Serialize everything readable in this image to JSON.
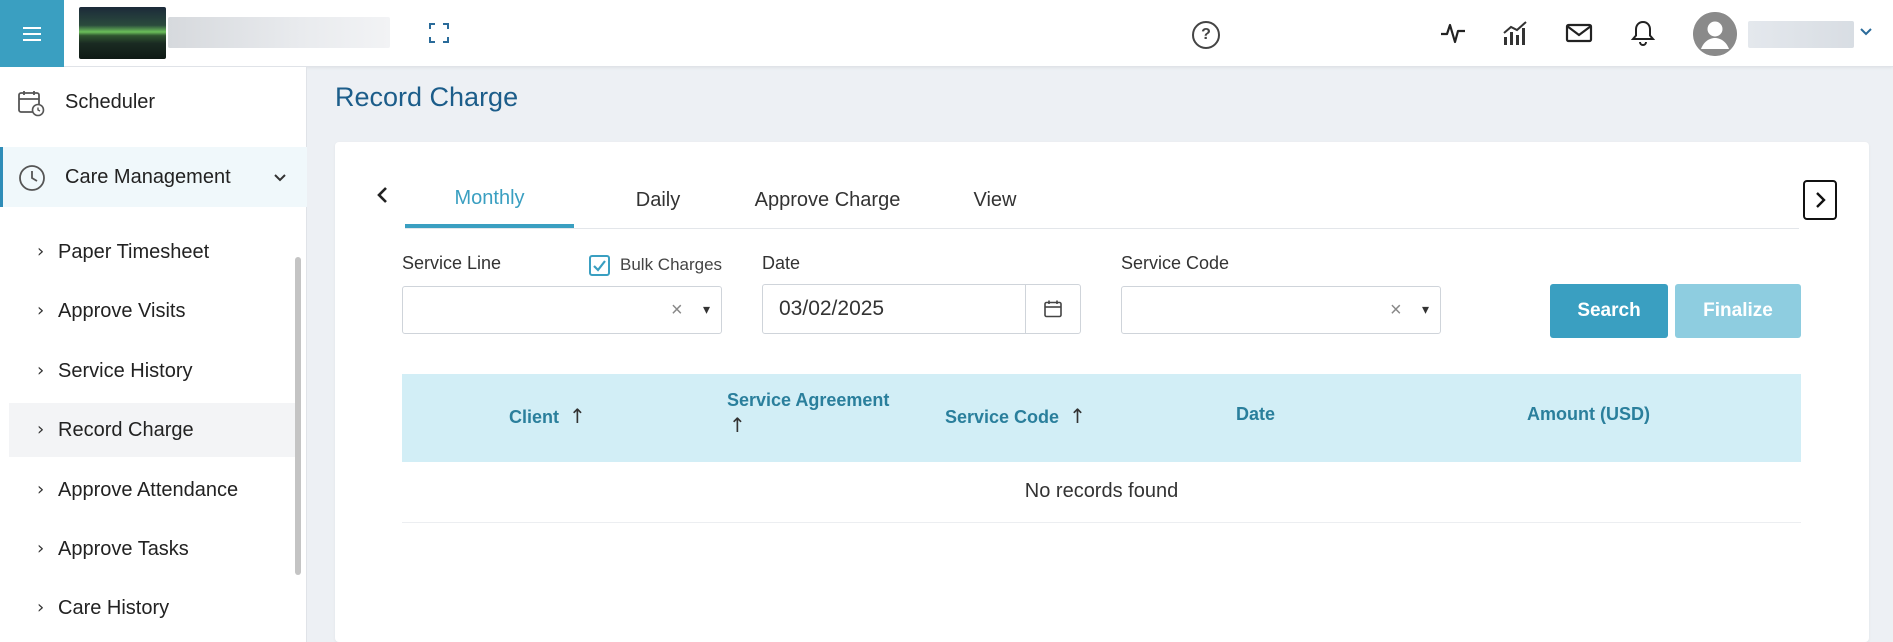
{
  "header": {
    "menu_icon": "hamburger-menu-icon",
    "expand_icon": "fullscreen-expand-icon",
    "help_label": "?",
    "icons": [
      "activity-pulse-icon",
      "bar-chart-icon",
      "mail-icon",
      "bell-icon"
    ],
    "avatar_icon": "user-avatar-icon",
    "user_menu_icon": "chevron-down-icon"
  },
  "sidebar": {
    "scheduler": {
      "label": "Scheduler",
      "icon": "calendar-clock-icon"
    },
    "care_management": {
      "label": "Care Management",
      "icon": "clock-icon",
      "expanded": true
    },
    "sub_items": [
      {
        "label": "Paper Timesheet"
      },
      {
        "label": "Approve Visits"
      },
      {
        "label": "Service History"
      },
      {
        "label": "Record Charge",
        "active": true
      },
      {
        "label": "Approve Attendance"
      },
      {
        "label": "Approve Tasks"
      },
      {
        "label": "Care History"
      }
    ],
    "sub_arrow": "›"
  },
  "page": {
    "title": "Record Charge"
  },
  "tabs": [
    {
      "label": "Monthly",
      "active": true
    },
    {
      "label": "Daily"
    },
    {
      "label": "Approve Charge"
    },
    {
      "label": "View"
    }
  ],
  "form": {
    "service_line": {
      "label": "Service Line",
      "value": "",
      "clear": "×",
      "caret": "▾"
    },
    "bulk_charges": {
      "label": "Bulk Charges",
      "checked": true
    },
    "date": {
      "label": "Date",
      "value": "03/02/2025"
    },
    "service_code": {
      "label": "Service Code",
      "value": "",
      "clear": "×",
      "caret": "▾"
    },
    "search_label": "Search",
    "finalize_label": "Finalize"
  },
  "table": {
    "columns": [
      {
        "label": "Client",
        "sortable": true
      },
      {
        "label": "Service Agreement",
        "sortable": true
      },
      {
        "label": "Service Code",
        "sortable": true
      },
      {
        "label": "Date",
        "sortable": false
      },
      {
        "label": "Amount (USD)",
        "sortable": false
      }
    ],
    "sort_arrow": "↑",
    "empty_message": "No records found"
  },
  "colors": {
    "accent": "#3a9fc1",
    "title": "#1c5d8a",
    "table_header_bg": "#d2eef6",
    "table_header_text": "#2a7f9c",
    "finalize_disabled": "#8ecde0"
  }
}
